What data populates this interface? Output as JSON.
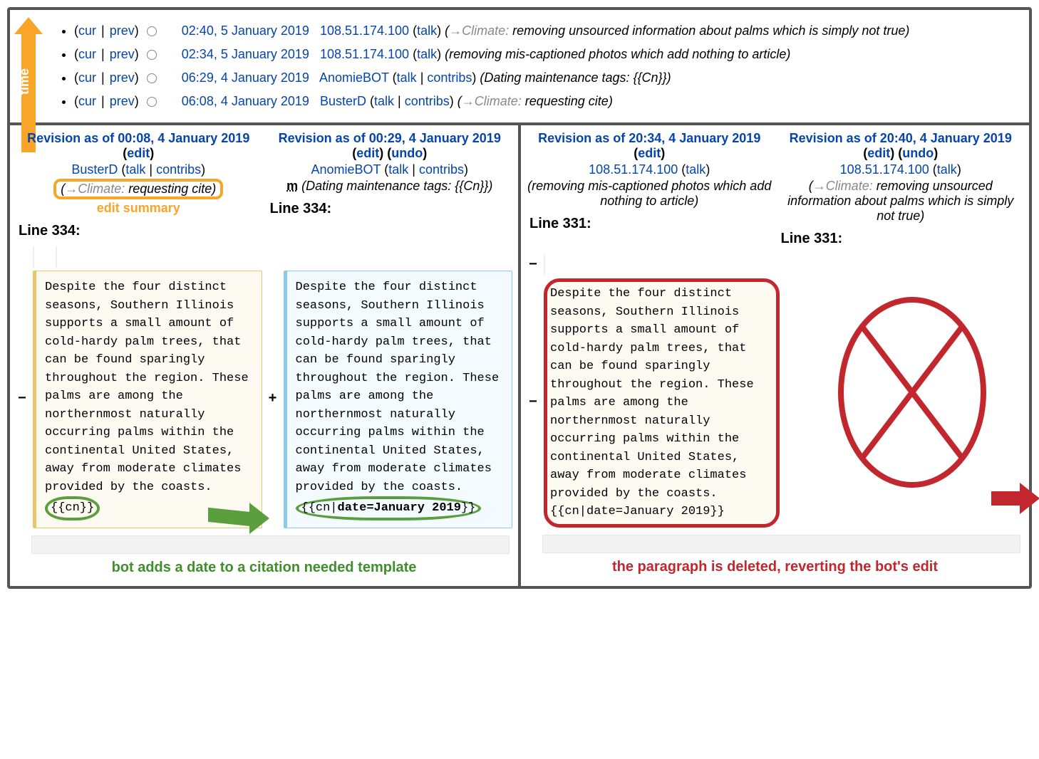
{
  "timeArrowLabel": "time",
  "history": [
    {
      "cur": "cur",
      "prev": "prev",
      "timestamp": "02:40, 5 January 2019",
      "user": "108.51.174.100",
      "talk": "talk",
      "contribs": null,
      "sectionLabel": "Climate:",
      "summary": "removing unsourced information about palms which is simply not true"
    },
    {
      "cur": "cur",
      "prev": "prev",
      "timestamp": "02:34, 5 January 2019",
      "user": "108.51.174.100",
      "talk": "talk",
      "contribs": null,
      "sectionLabel": null,
      "summary": "removing mis-captioned photos which add nothing to article"
    },
    {
      "cur": "cur",
      "prev": "prev",
      "timestamp": "06:29, 4 January 2019",
      "user": "AnomieBOT",
      "talk": "talk",
      "contribs": "contribs",
      "sectionLabel": null,
      "summary": "Dating maintenance tags: {{Cn}}"
    },
    {
      "cur": "cur",
      "prev": "prev",
      "timestamp": "06:08, 4 January 2019",
      "user": "BusterD",
      "talk": "talk",
      "contribs": "contribs",
      "sectionLabel": "Climate:",
      "summary": "requesting cite"
    }
  ],
  "diffLeft": {
    "old": {
      "title": "Revision as of 00:08, 4 January 2019",
      "editLabel": "edit",
      "user": "BusterD",
      "talk": "talk",
      "contribs": "contribs",
      "sectionLabel": "Climate:",
      "summary": "requesting cite",
      "line": "Line 334:",
      "paragraph": "Despite the four distinct seasons, Southern Illinois supports a small amount of cold-hardy palm trees, that can be found sparingly throughout the region. These palms are among the northernmost naturally occurring palms within the continental United States, away from moderate climates provided by the coasts.",
      "template": "{{cn}}"
    },
    "new": {
      "title": "Revision as of 00:29, 4 January 2019",
      "editLabel": "edit",
      "undoLabel": "undo",
      "user": "AnomieBOT",
      "talk": "talk",
      "contribs": "contribs",
      "minorFlag": "m",
      "summary": "Dating maintenance tags: {{Cn}}",
      "line": "Line 334:",
      "paragraph": "Despite the four distinct seasons, Southern Illinois supports a small amount of cold-hardy palm trees, that can be found sparingly throughout the region. These palms are among the northernmost naturally occurring palms within the continental United States, away from moderate climates provided by the coasts.",
      "templatePrefix": "{{cn|",
      "templateBold": "date=January 2019",
      "templateSuffix": "}}"
    },
    "editSummaryCaption": "edit summary",
    "annotation": "bot adds a date to a citation needed template"
  },
  "diffRight": {
    "old": {
      "title": "Revision as of 20:34, 4 January 2019",
      "editLabel": "edit",
      "user": "108.51.174.100",
      "talk": "talk",
      "summary": "removing mis-captioned photos which add nothing to article",
      "line": "Line 331:",
      "paragraph": "Despite the four distinct seasons, Southern Illinois supports a small amount of cold-hardy palm trees, that can be found sparingly throughout the region. These palms are among the northernmost naturally occurring palms within the continental United States, away from moderate climates provided by the coasts. {{cn|date=January 2019}}"
    },
    "new": {
      "title": "Revision as of 20:40, 4 January 2019",
      "editLabel": "edit",
      "undoLabel": "undo",
      "user": "108.51.174.100",
      "talk": "talk",
      "sectionLabel": "Climate:",
      "summary": "removing unsourced information about palms which is simply not true",
      "line": "Line 331:"
    },
    "annotation": "the paragraph is deleted, reverting the bot's edit"
  }
}
